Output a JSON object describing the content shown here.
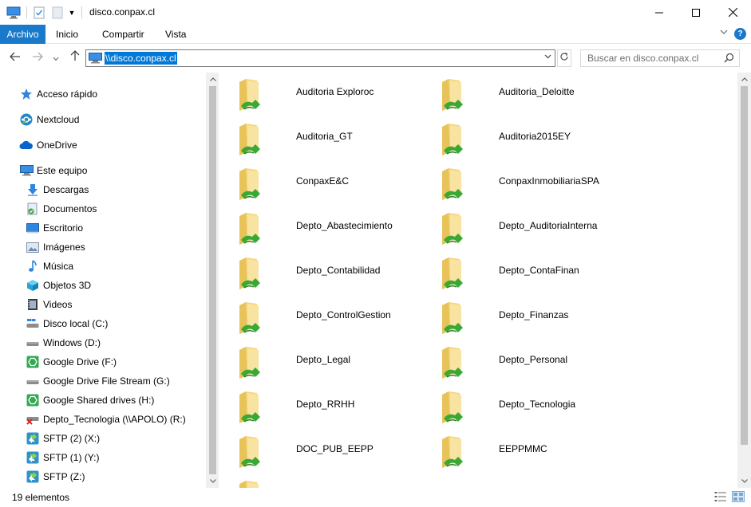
{
  "window": {
    "title": "disco.conpax.cl"
  },
  "ribbon": {
    "tabs": [
      {
        "label": "Archivo"
      },
      {
        "label": "Inicio"
      },
      {
        "label": "Compartir"
      },
      {
        "label": "Vista"
      }
    ],
    "help_label": "?"
  },
  "address": {
    "path": "\\\\disco.conpax.cl"
  },
  "search": {
    "placeholder": "Buscar en disco.conpax.cl"
  },
  "navpane": {
    "items": [
      {
        "label": "Acceso rápido",
        "icon": "star-icon"
      },
      {
        "label": "Nextcloud",
        "icon": "nextcloud-icon"
      },
      {
        "label": "OneDrive",
        "icon": "cloud-icon"
      },
      {
        "label": "Este equipo",
        "icon": "computer-icon"
      },
      {
        "label": "Descargas",
        "icon": "download-icon"
      },
      {
        "label": "Documentos",
        "icon": "document-icon"
      },
      {
        "label": "Escritorio",
        "icon": "desktop-icon"
      },
      {
        "label": "Imágenes",
        "icon": "image-icon"
      },
      {
        "label": "Música",
        "icon": "music-icon"
      },
      {
        "label": "Objetos 3D",
        "icon": "cube-icon"
      },
      {
        "label": "Videos",
        "icon": "video-icon"
      },
      {
        "label": "Disco local (C:)",
        "icon": "drive-icon"
      },
      {
        "label": "Windows (D:)",
        "icon": "drive-icon"
      },
      {
        "label": "Google Drive (F:)",
        "icon": "google-drive-icon"
      },
      {
        "label": "Google Drive File Stream (G:)",
        "icon": "drive-icon"
      },
      {
        "label": "Google Shared drives (H:)",
        "icon": "google-drive-icon"
      },
      {
        "label": "Depto_Tecnologia (\\\\APOLO) (R:)",
        "icon": "disconnected-drive-icon"
      },
      {
        "label": "SFTP (2) (X:)",
        "icon": "sftp-icon"
      },
      {
        "label": "SFTP (1) (Y:)",
        "icon": "sftp-icon"
      },
      {
        "label": "SFTP (Z:)",
        "icon": "sftp-icon"
      }
    ]
  },
  "folders": [
    {
      "name": "Auditoria Exploroc"
    },
    {
      "name": "Auditoria_Deloitte"
    },
    {
      "name": "Auditoria_GT"
    },
    {
      "name": "Auditoria2015EY"
    },
    {
      "name": "ConpaxE&C"
    },
    {
      "name": "ConpaxInmobiliariaSPA"
    },
    {
      "name": "Depto_Abastecimiento"
    },
    {
      "name": "Depto_AuditoriaInterna"
    },
    {
      "name": "Depto_Contabilidad"
    },
    {
      "name": "Depto_ContaFinan"
    },
    {
      "name": "Depto_ControlGestion"
    },
    {
      "name": "Depto_Finanzas"
    },
    {
      "name": "Depto_Legal"
    },
    {
      "name": "Depto_Personal"
    },
    {
      "name": "Depto_RRHH"
    },
    {
      "name": "Depto_Tecnologia"
    },
    {
      "name": "DOC_PUB_EEPP"
    },
    {
      "name": "EEPPMMC"
    },
    {
      "name": ""
    }
  ],
  "status": {
    "count_label": "19 elementos"
  },
  "colors": {
    "accent": "#0078d7",
    "file_tab": "#1979ca",
    "folder": "#f5d67a",
    "share": "#39a935"
  }
}
